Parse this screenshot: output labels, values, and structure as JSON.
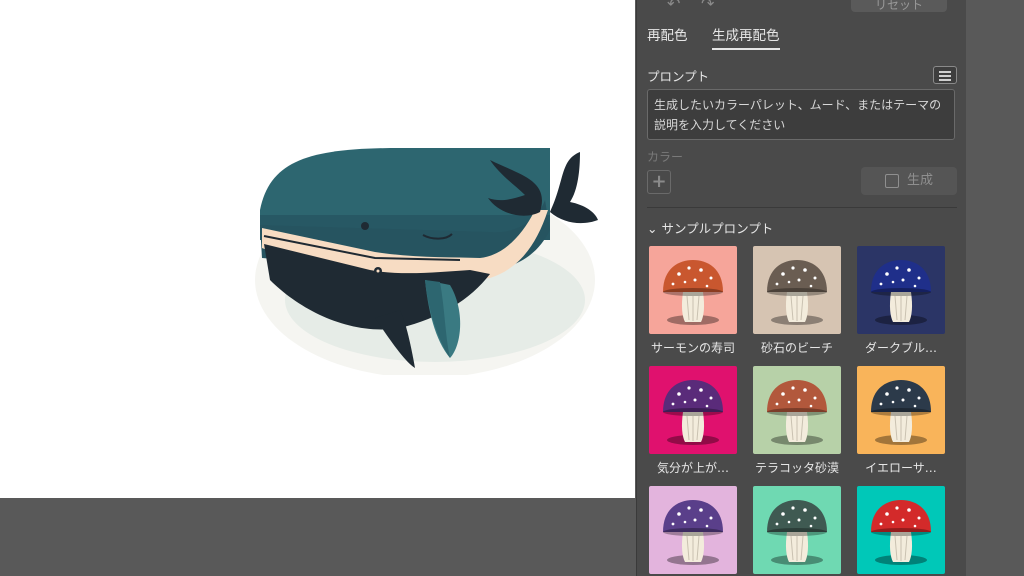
{
  "toolbar": {
    "undo_icon": "undo-icon",
    "redo_icon": "redo-icon",
    "reset_label": "リセット"
  },
  "tabs": [
    {
      "label": "再配色",
      "active": false
    },
    {
      "label": "生成再配色",
      "active": true
    }
  ],
  "prompt": {
    "label": "プロンプト",
    "placeholder": "生成したいカラーパレット、ムード、またはテーマの説明を入力してください",
    "menu_icon": "menu-icon"
  },
  "colors": {
    "label": "カラー",
    "add_icon": "plus-icon"
  },
  "generate": {
    "label": "生成",
    "icon": "generate-icon"
  },
  "samples": {
    "header": "サンプルプロンプト",
    "items": [
      {
        "label": "サーモンの寿司",
        "bg": "#f6a59a",
        "cap": "#c9572f"
      },
      {
        "label": "砂石のビーチ",
        "bg": "#d6c4b2",
        "cap": "#6a5d52"
      },
      {
        "label": "ダークブル…",
        "bg": "#2b3566",
        "cap": "#1f2f8a"
      },
      {
        "label": "気分が上が…",
        "bg": "#e0116e",
        "cap": "#5a2b7a"
      },
      {
        "label": "テラコッタ砂漠",
        "bg": "#b7d1a8",
        "cap": "#b2583c"
      },
      {
        "label": "イエローサ…",
        "bg": "#f9b45a",
        "cap": "#2c3a4a"
      },
      {
        "label": "",
        "bg": "#e3b4dd",
        "cap": "#5a3f8a"
      },
      {
        "label": "",
        "bg": "#6fd9b2",
        "cap": "#3f5a52"
      },
      {
        "label": "",
        "bg": "#00c8b8",
        "cap": "#d32a2a"
      }
    ]
  }
}
